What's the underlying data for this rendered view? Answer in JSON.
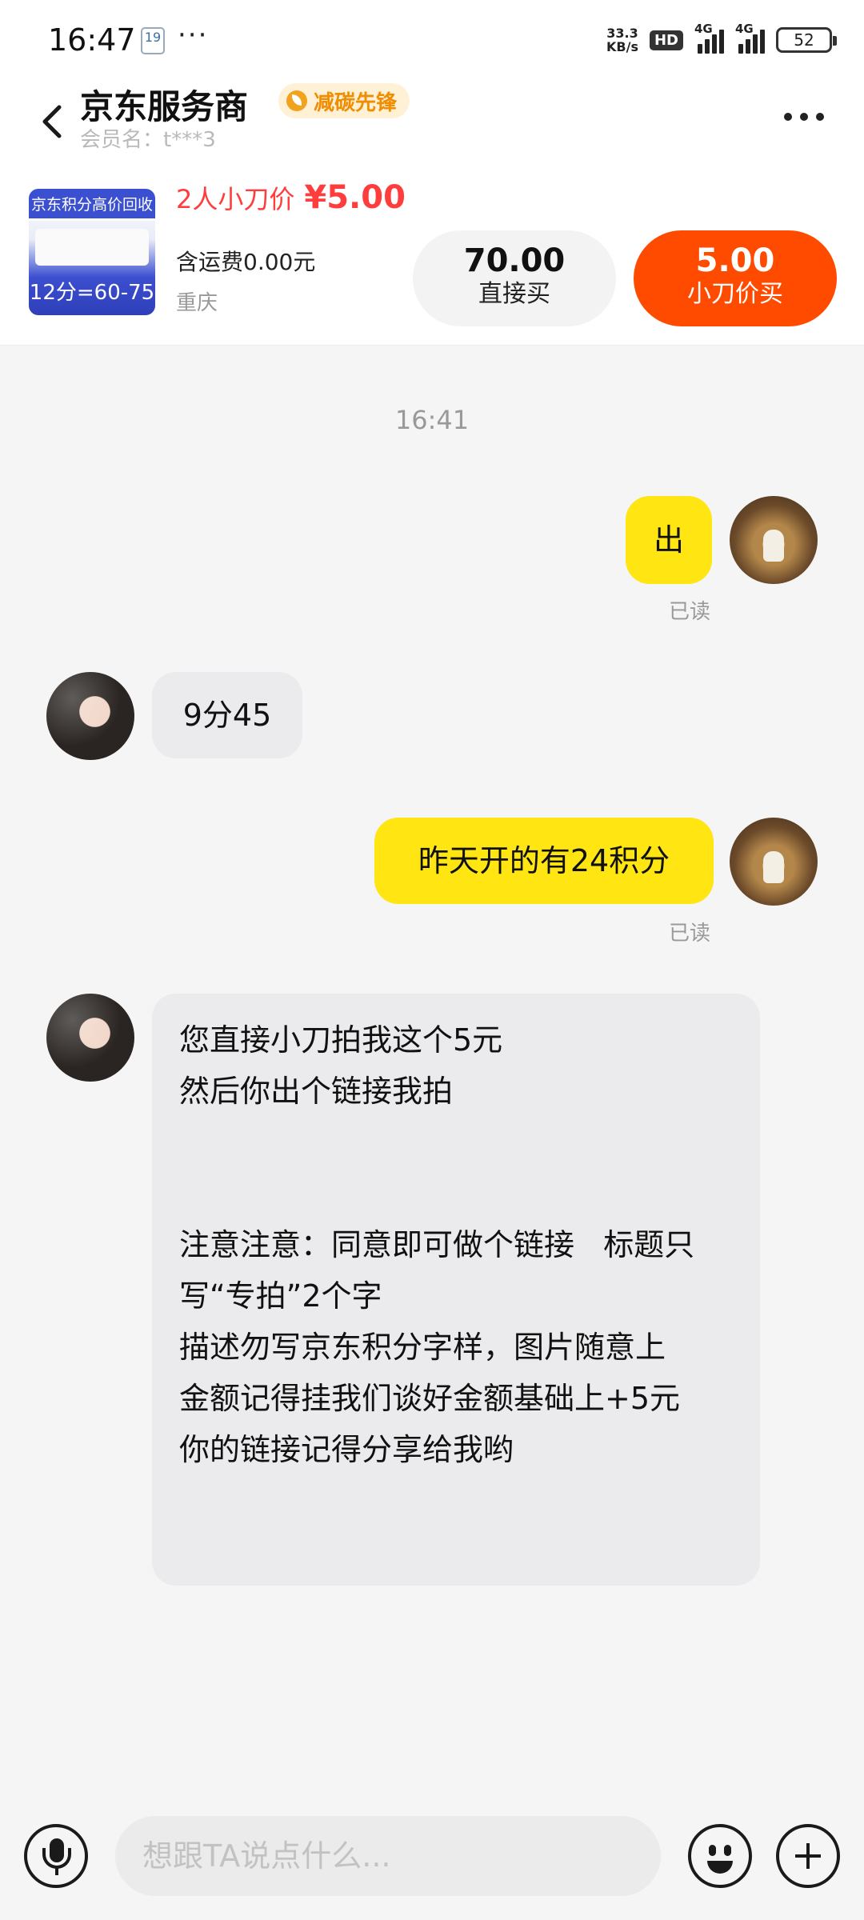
{
  "status_bar": {
    "time": "16:47",
    "calendar_day": "19",
    "more_dots": "···",
    "net_speed_value": "33.3",
    "net_speed_unit": "KB/s",
    "hd_label": "HD",
    "sim1_label": "4G",
    "sim2_label": "4G",
    "battery_level": "52"
  },
  "header": {
    "title": "京东服务商",
    "badge_label": "减碳先锋",
    "member_line": "会员名：t***3"
  },
  "product": {
    "thumb_top_text": "京东积分高价回收",
    "thumb_bottom_text": "12分=60-75",
    "promo_label": "2人小刀价",
    "promo_price": "¥5.00",
    "shipping": "含运费0.00元",
    "location": "重庆",
    "buy_price": "70.00",
    "buy_label": "直接买",
    "knife_price": "5.00",
    "knife_label": "小刀价买"
  },
  "chat": {
    "time_divider": "16:41",
    "messages": [
      {
        "sender": "me",
        "text": "出",
        "status": "已读"
      },
      {
        "sender": "other",
        "text": "9分45"
      },
      {
        "sender": "me",
        "text": "昨天开的有24积分",
        "status": "已读"
      },
      {
        "sender": "other",
        "text": "您直接小刀拍我这个5元\n然后你出个链接我拍\n\n\n注意注意：同意即可做个链接   标题只写“专拍”2个字\n描述勿写京东积分字样，图片随意上\n金额记得挂我们谈好金额基础上+5元\n你的链接记得分享给我哟"
      }
    ]
  },
  "input_bar": {
    "placeholder": "想跟TA说点什么..."
  },
  "colors": {
    "accent_orange": "#ff4b00",
    "price_red": "#ff3d3d",
    "my_bubble": "#ffe512",
    "other_bubble": "#ebebed"
  }
}
